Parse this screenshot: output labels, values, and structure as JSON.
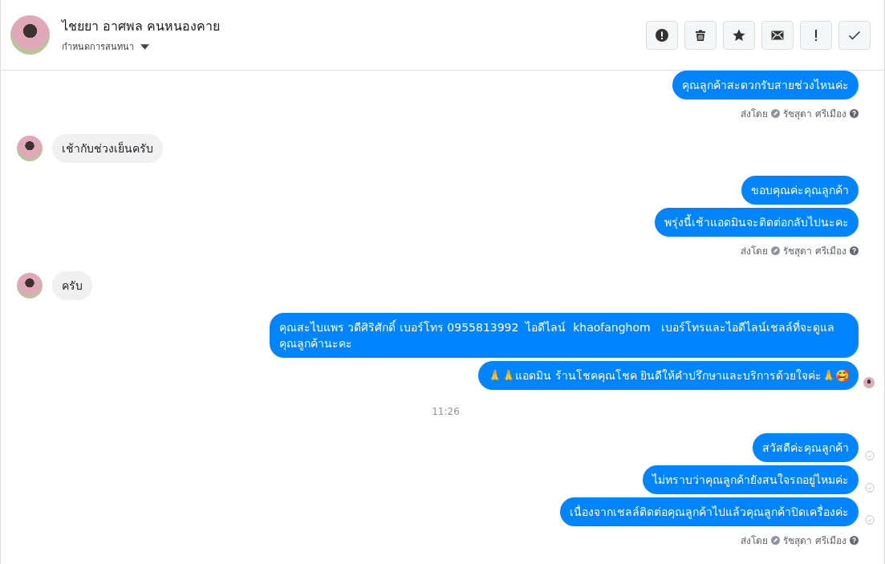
{
  "header": {
    "name": "ไชยยา อาศพล คนหนองคาย",
    "subtitle": "กำหนดการสนทนา",
    "buttons": [
      {
        "kind": "alert"
      },
      {
        "kind": "trash"
      },
      {
        "kind": "star"
      },
      {
        "kind": "mail"
      },
      {
        "kind": "exclaim"
      },
      {
        "kind": "check"
      }
    ]
  },
  "groups": [
    {
      "kind": "outgoing",
      "messages": [
        {
          "text": "คุณลูกค้าสะดวกรับสายช่วงไหนค่ะ"
        }
      ],
      "note": {
        "label": "ส่งโดย",
        "name": "รัชสุดา ศรีเมือง"
      }
    },
    {
      "kind": "incoming",
      "messages": [
        {
          "text": "เช้ากับช่วงเย็นครับ"
        }
      ]
    },
    {
      "kind": "outgoing",
      "messages": [
        {
          "text": "ขอบคุณค่ะคุณลูกค้า"
        },
        {
          "text": "พรุ่งนี้เช้าแอดมินจะติดต่อกลับไปนะคะ"
        }
      ],
      "note": {
        "label": "ส่งโดย",
        "name": "รัชสุดา ศรีเมือง"
      }
    },
    {
      "kind": "incoming",
      "messages": [
        {
          "text": "ครับ"
        }
      ]
    },
    {
      "kind": "outgoing",
      "messages": [
        {
          "text": "คุณสะไบแพร วดีศิริศักดิ์ เบอร์โทร 0955813992  ไอดีไลน์  khaofanghom   เบอร์โทรและไอดีไลน์เชลล์ที่จะดูแลคุณลูกค้านะคะ"
        },
        {
          "text": "🙏🙏แอดมิน ร้านโชคคุณโชค ยินดีให้คำปรึกษาและบริการด้วยใจค่ะ🙏🥰",
          "seen": true
        }
      ]
    },
    {
      "kind": "time",
      "text": "11:26"
    },
    {
      "kind": "outgoing",
      "messages": [
        {
          "text": "สวัสดีค่ะคุณลูกค้า",
          "delivered": true
        },
        {
          "text": "ไม่ทราบว่าคุณลูกค้ายังสนใจรถอยู่ไหมค่ะ",
          "delivered": true
        },
        {
          "text": "เนื่องจากเชลล์ติดต่อคุณลูกค้าไปแล้วคุณลูกค้าปิดเครื่องค่ะ",
          "delivered": true
        }
      ],
      "note": {
        "label": "ส่งโดย",
        "name": "รัชสุดา ศรีเมือง"
      }
    }
  ]
}
